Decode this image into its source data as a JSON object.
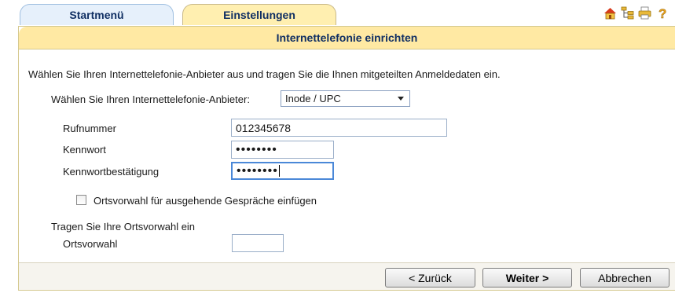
{
  "tabs": {
    "start": "Startmenü",
    "settings": "Einstellungen"
  },
  "icons": [
    "home-icon",
    "sitemap-icon",
    "print-icon",
    "help-icon"
  ],
  "panel": {
    "title": "Internettelefonie einrichten"
  },
  "intro": "Wählen Sie Ihren Internettelefonie-Anbieter aus und tragen Sie die Ihnen mitgeteilten Anmeldedaten ein.",
  "provider": {
    "label": "Wählen Sie Ihren Internettelefonie-Anbieter:",
    "selected": "Inode / UPC"
  },
  "fields": {
    "phone": {
      "label": "Rufnummer",
      "value": "012345678"
    },
    "password": {
      "label": "Kennwort",
      "value": "••••••••"
    },
    "password_confirm": {
      "label": "Kennwortbestätigung",
      "value": "••••••••"
    }
  },
  "checkbox": {
    "label": "Ortsvorwahl für ausgehende Gespräche einfügen",
    "checked": false
  },
  "area_code": {
    "heading": "Tragen Sie Ihre Ortsvorwahl ein",
    "label": "Ortsvorwahl",
    "value": ""
  },
  "buttons": {
    "back": "< Zurück",
    "next": "Weiter >",
    "cancel": "Abbrechen"
  }
}
